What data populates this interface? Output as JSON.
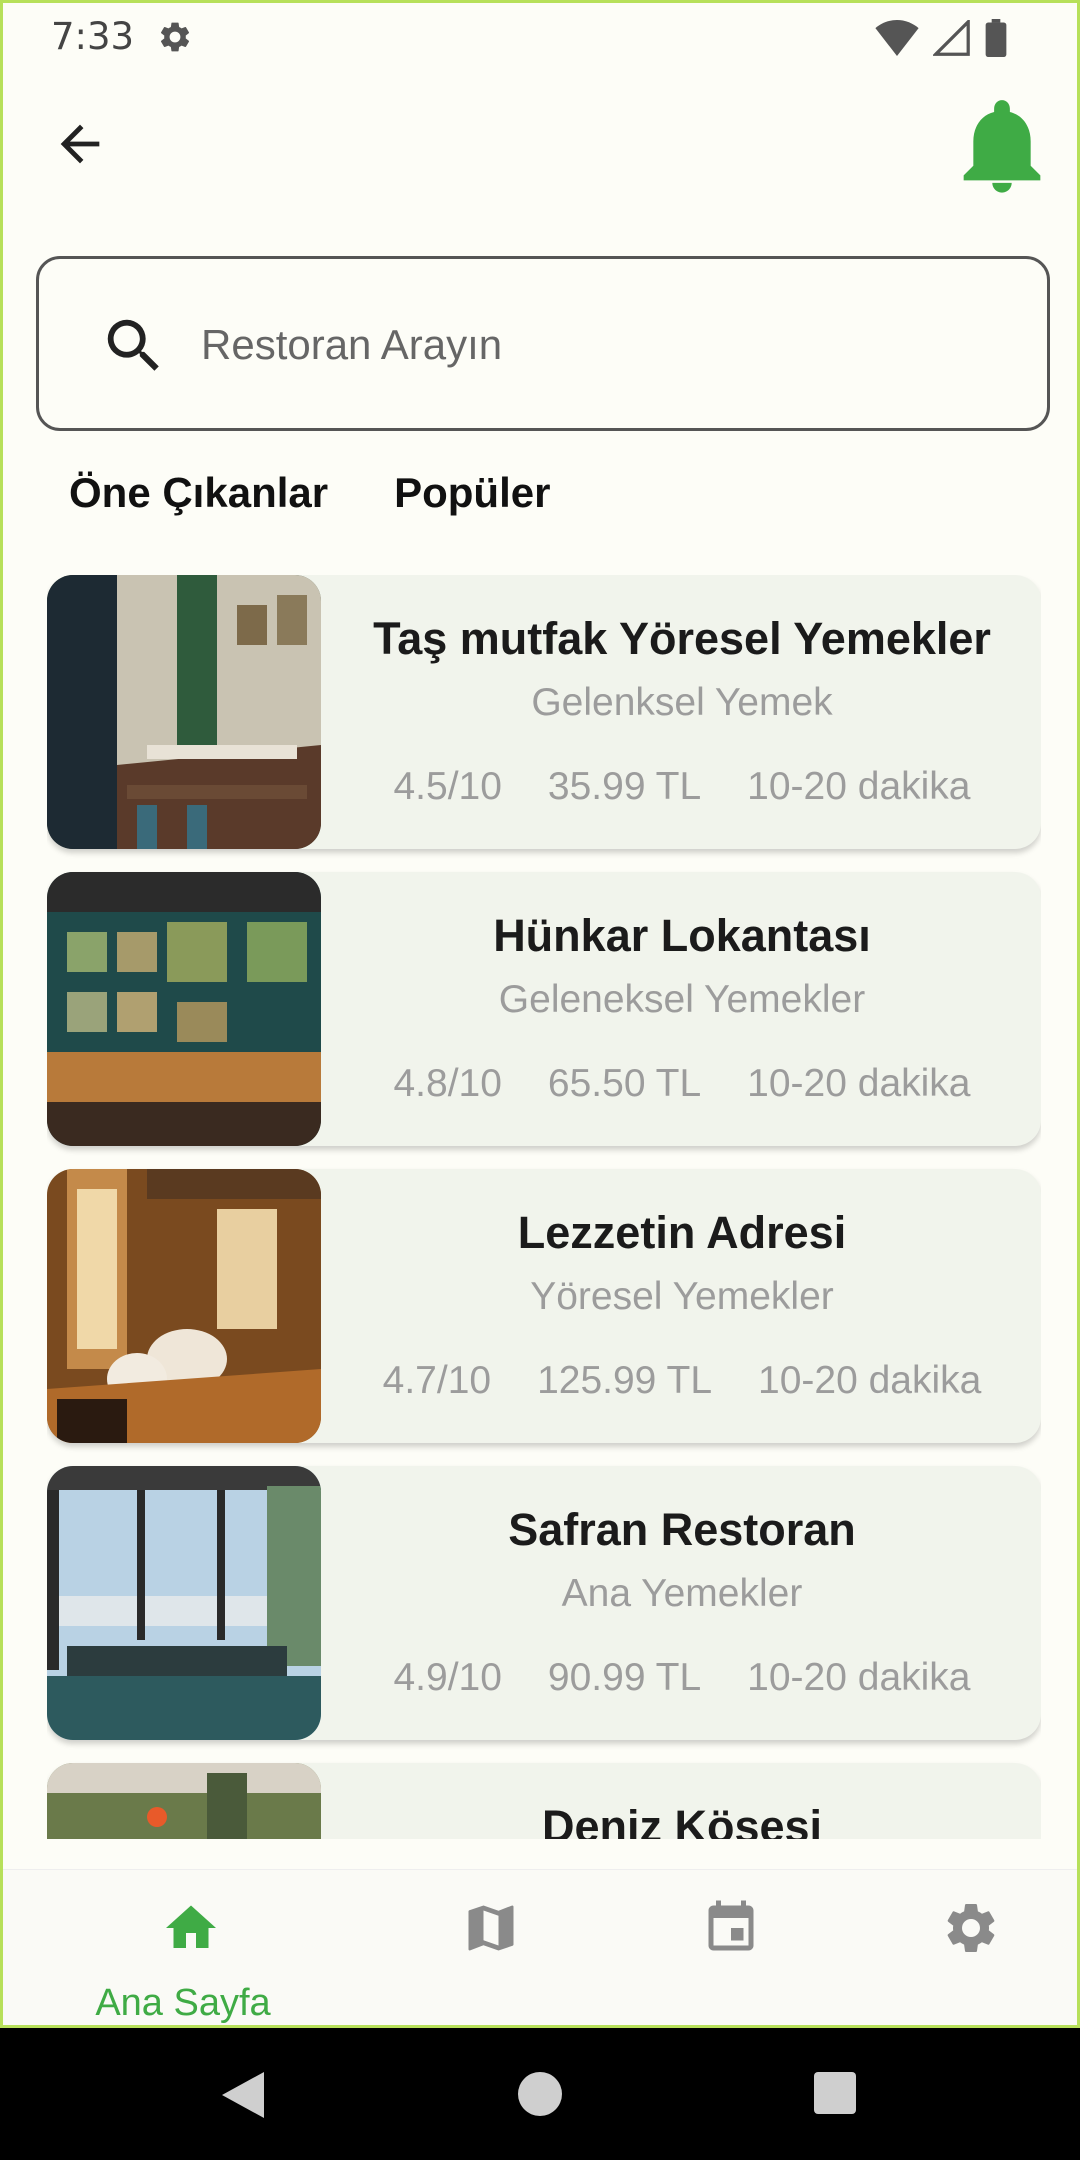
{
  "status": {
    "time": "7:33"
  },
  "search": {
    "placeholder": "Restoran Arayın"
  },
  "tabs": [
    {
      "label": "Öne Çıkanlar"
    },
    {
      "label": "Popüler"
    }
  ],
  "restaurants": [
    {
      "name": "Taş mutfak Yöresel Yemekler",
      "category": "Gelenksel Yemek",
      "rating": "4.5/10",
      "price": "35.99 TL",
      "time": "10-20 dakika"
    },
    {
      "name": "Hünkar Lokantası",
      "category": "Geleneksel Yemekler",
      "rating": "4.8/10",
      "price": "65.50 TL",
      "time": "10-20 dakika"
    },
    {
      "name": "Lezzetin Adresi",
      "category": "Yöresel Yemekler",
      "rating": "4.7/10",
      "price": "125.99 TL",
      "time": "10-20 dakika"
    },
    {
      "name": "Safran Restoran",
      "category": "Ana Yemekler",
      "rating": "4.9/10",
      "price": "90.99 TL",
      "time": "10-20 dakika"
    },
    {
      "name": "Deniz Köşesi",
      "category": "",
      "rating": "",
      "price": "",
      "time": ""
    }
  ],
  "bottom_nav": {
    "home_label": "Ana Sayfa"
  },
  "colors": {
    "accent": "#3fab45",
    "card_bg": "#f1f4ec",
    "background": "#fdfdf7"
  },
  "icons": [
    "settings-icon",
    "wifi-icon",
    "signal-icon",
    "battery-icon",
    "back-arrow-icon",
    "bell-icon",
    "search-icon",
    "home-icon",
    "map-icon",
    "calendar-icon",
    "settings-icon"
  ]
}
